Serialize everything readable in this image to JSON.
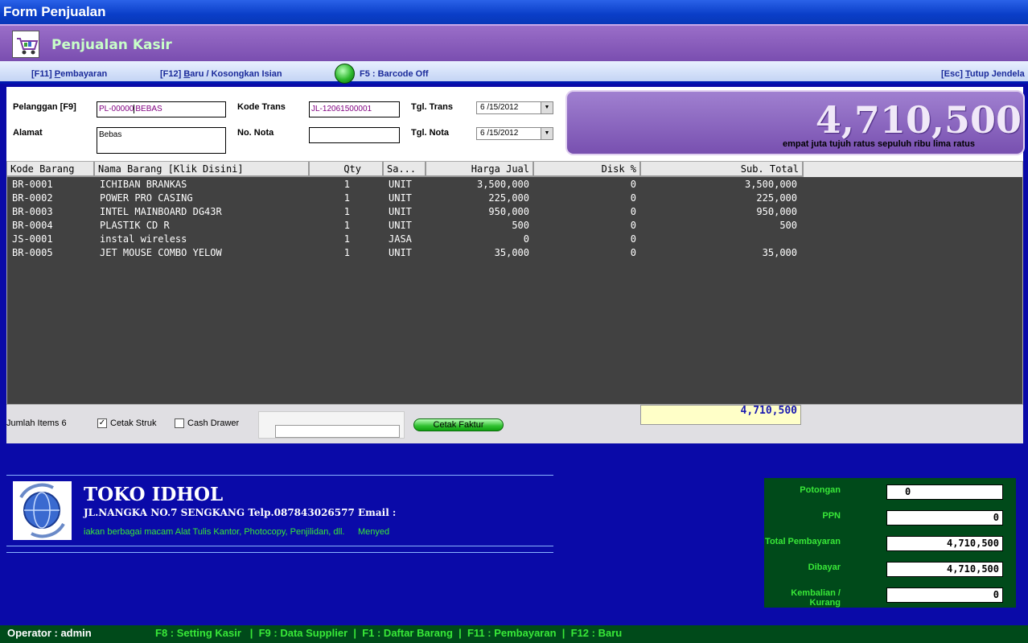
{
  "window": {
    "title": "Form Penjualan"
  },
  "banner": {
    "title": "Penjualan Kasir"
  },
  "hotkeys": {
    "pembayaran_prefix": "[F11] ",
    "pembayaran_u": "P",
    "pembayaran_rest": "embayaran",
    "baru_prefix": "[F12] ",
    "baru_u": "B",
    "baru_rest": "aru / Kosongkan Isian",
    "barcode": "F5 : Barcode Off",
    "tutup_prefix": "[Esc] ",
    "tutup_u": "T",
    "tutup_rest": "utup Jendela"
  },
  "form": {
    "pelanggan_label": "Pelanggan [F9]",
    "pelanggan_code": "PL-00000",
    "pelanggan_name": "BEBAS",
    "alamat_label": "Alamat",
    "alamat_value": "Bebas",
    "kode_trans_label": "Kode Trans",
    "kode_trans_value": "JL-12061500001",
    "no_nota_label": "No. Nota",
    "no_nota_value": "",
    "tgl_trans_label": "Tgl. Trans",
    "tgl_trans_value": "6 /15/2012",
    "tgl_nota_label": "Tgl. Nota",
    "tgl_nota_value": "6 /15/2012"
  },
  "total": {
    "amount": "4,710,500",
    "words": "empat juta tujuh ratus sepuluh ribu lima ratus"
  },
  "grid": {
    "headers": [
      "Kode Barang",
      "Nama Barang [Klik Disini]",
      "Qty",
      "Sa...",
      "Harga Jual",
      "Disk %",
      "Sub. Total"
    ],
    "rows": [
      [
        "BR-0001",
        "ICHIBAN BRANKAS",
        "1",
        "UNIT",
        "3,500,000",
        "0",
        "3,500,000"
      ],
      [
        "BR-0002",
        "POWER PRO CASING",
        "1",
        "UNIT",
        "225,000",
        "0",
        "225,000"
      ],
      [
        "BR-0003",
        "INTEL MAINBOARD DG43R",
        "1",
        "UNIT",
        "950,000",
        "0",
        "950,000"
      ],
      [
        "BR-0004",
        "PLASTIK CD R",
        "1",
        "UNIT",
        "500",
        "0",
        "500"
      ],
      [
        "JS-0001",
        "instal wireless",
        "1",
        "JASA",
        "0",
        "0",
        ""
      ],
      [
        "BR-0005",
        "JET MOUSE COMBO YELOW",
        "1",
        "UNIT",
        "35,000",
        "0",
        "35,000"
      ]
    ]
  },
  "footer": {
    "jumlah_items": "Jumlah Items 6",
    "cetak_struk": "Cetak Struk",
    "cetak_struk_checked": "✓",
    "cash_drawer": "Cash Drawer",
    "cetak_faktur": "Cetak Faktur",
    "grand_total": "4,710,500"
  },
  "shop": {
    "name": "TOKO IDHOL",
    "address": "JL.NANGKA NO.7 SENGKANG Telp.087843026577 Email :",
    "tagline": "iakan berbagai macam Alat Tulis Kantor, Photocopy, Penjilidan, dll.",
    "tagline2": "Menyed"
  },
  "payment": {
    "potongan_label": "Potongan",
    "potongan_value": "0",
    "ppn_label": "PPN",
    "ppn_value": "0",
    "total_label": "Total Pembayaran",
    "total_value": "4,710,500",
    "dibayar_label": "Dibayar",
    "dibayar_value": "4,710,500",
    "kembalian_label": "Kembalian / Kurang",
    "kembalian_value": "0"
  },
  "statusbar": {
    "operator": "Operator : admin",
    "shortcuts": "F8 : Setting Kasir   |  F9 : Data Supplier  |  F1 : Daftar Barang  |  F11 : Pembayaran  |  F12 : Baru"
  }
}
